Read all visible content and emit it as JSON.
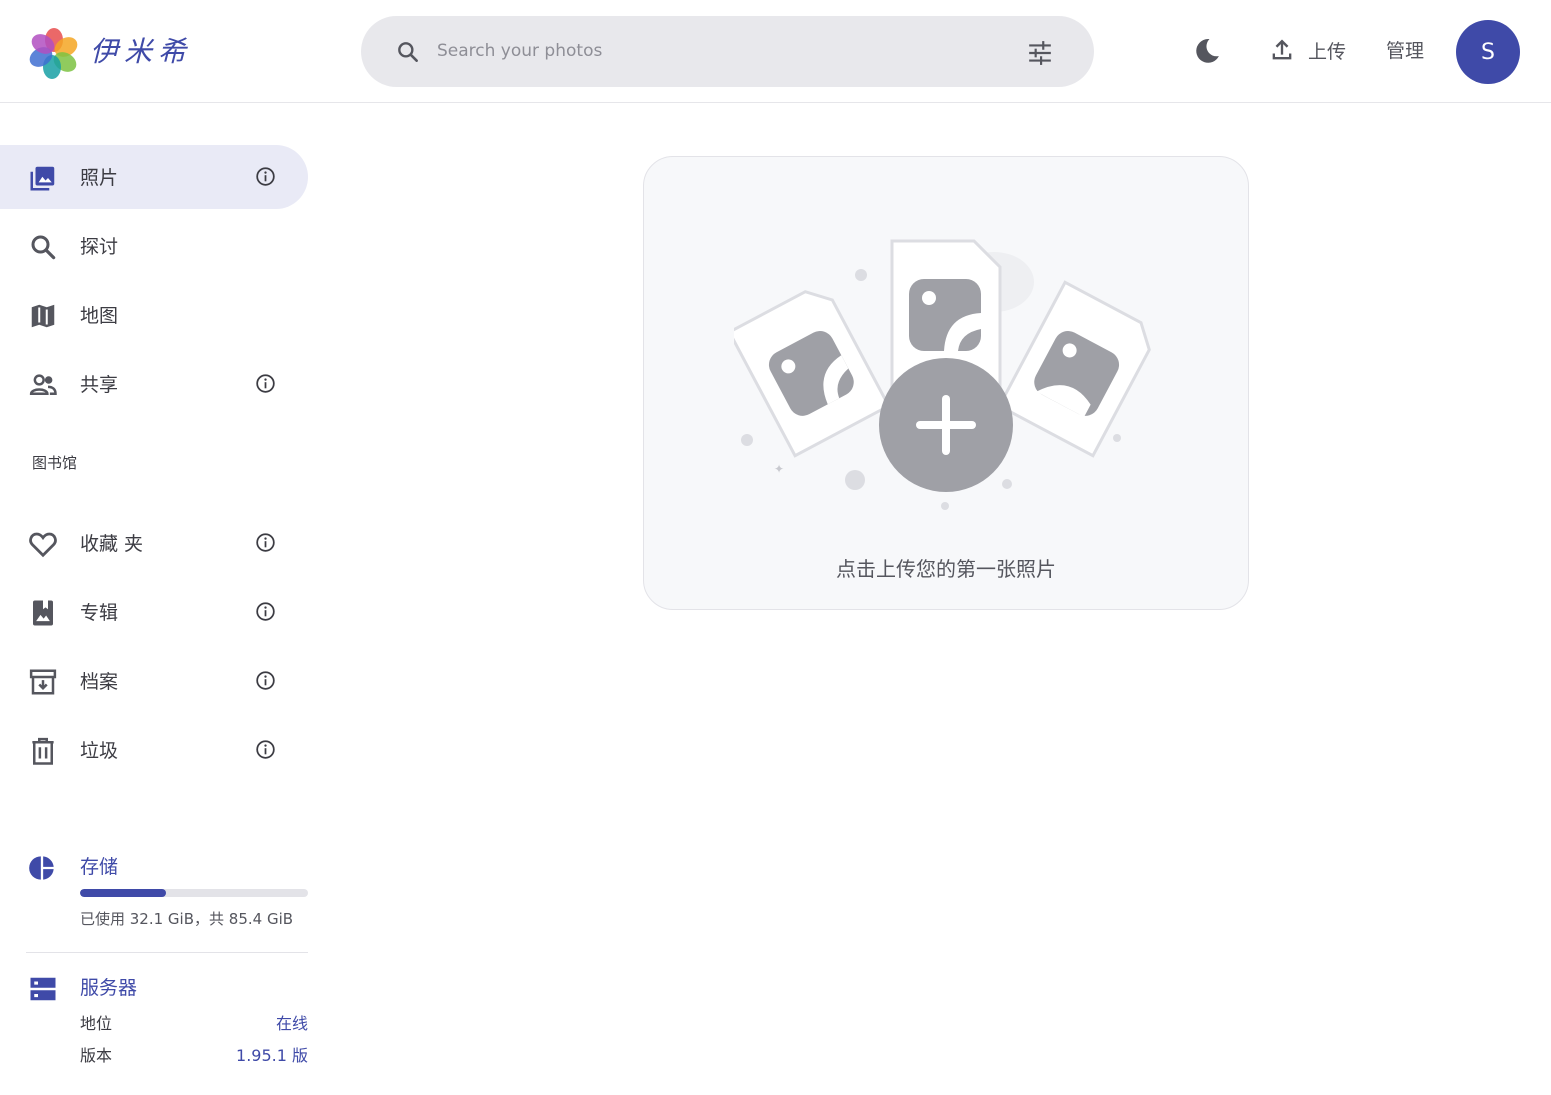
{
  "header": {
    "brand": "伊米希",
    "search_placeholder": "Search your photos",
    "upload_label": "上传",
    "manage_label": "管理",
    "avatar_initial": "S"
  },
  "sidebar": {
    "items": [
      {
        "label": "照片",
        "icon": "photos-icon",
        "active": true
      },
      {
        "label": "探讨",
        "icon": "search-icon"
      },
      {
        "label": "地图",
        "icon": "map-icon"
      },
      {
        "label": "共享",
        "icon": "people-icon"
      }
    ],
    "library_title": "图书馆",
    "library_items": [
      {
        "label": "收藏 夹",
        "icon": "heart-icon"
      },
      {
        "label": "专辑",
        "icon": "album-icon"
      },
      {
        "label": "档案",
        "icon": "archive-icon"
      },
      {
        "label": "垃圾",
        "icon": "trash-icon"
      }
    ],
    "storage": {
      "title": "存储",
      "used_fraction": 0.376,
      "text": "已使用 32.1 GiB，共 85.4 GiB"
    },
    "server": {
      "title": "服务器",
      "status_label": "地位",
      "status_value": "在线",
      "version_label": "版本",
      "version_value": "1.95.1 版"
    }
  },
  "main": {
    "empty_text": "点击上传您的第一张照片"
  },
  "colors": {
    "accent": "#3f4aa8",
    "active_bg": "#e9eaf6",
    "icon": "#55565e"
  }
}
